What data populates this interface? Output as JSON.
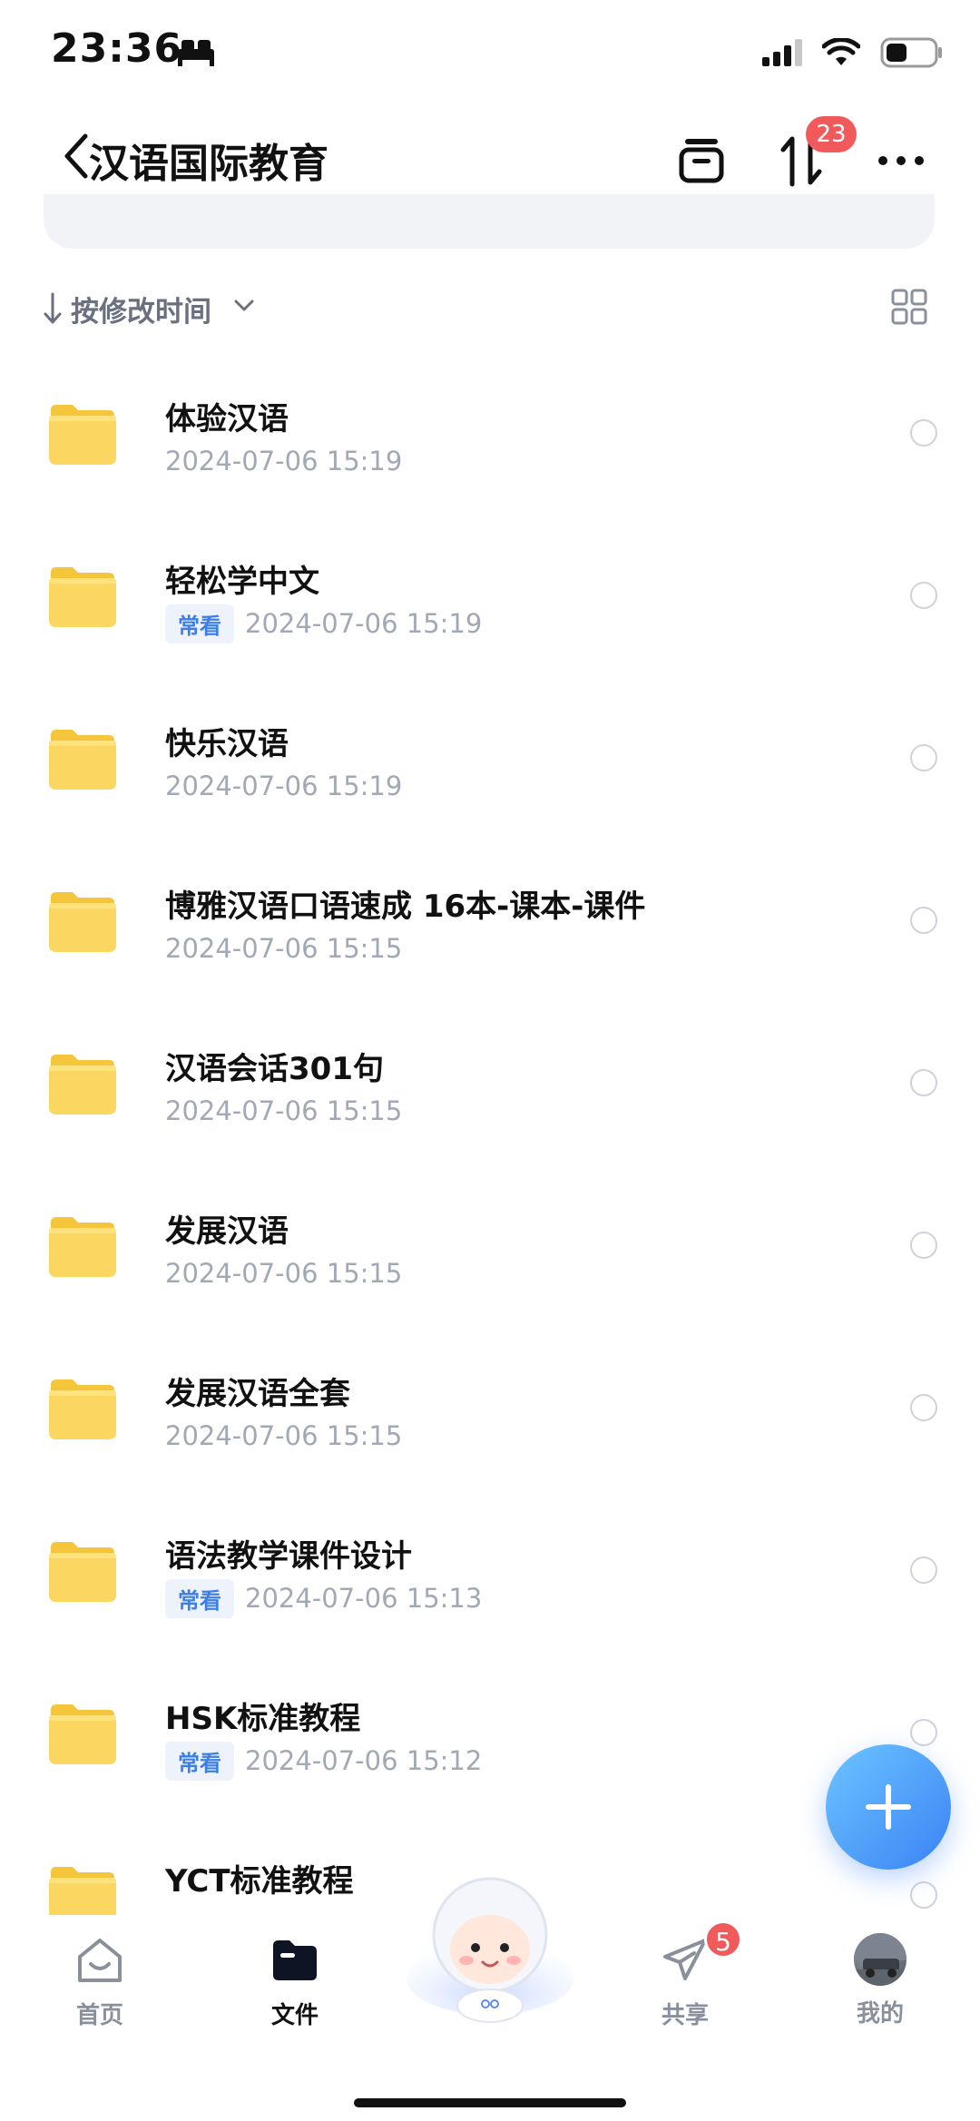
{
  "status_bar": {
    "time": "23:36"
  },
  "nav": {
    "title": "汉语国际教育",
    "badge_count": "23"
  },
  "sort": {
    "label": "按修改时间"
  },
  "files": [
    {
      "name": "体验汉语",
      "tag": "",
      "date": "2024-07-06 15:19"
    },
    {
      "name": "轻松学中文",
      "tag": "常看",
      "date": "2024-07-06 15:19"
    },
    {
      "name": "快乐汉语",
      "tag": "",
      "date": "2024-07-06 15:19"
    },
    {
      "name": "博雅汉语口语速成 16本-课本-课件",
      "tag": "",
      "date": "2024-07-06 15:15"
    },
    {
      "name": "汉语会话301句",
      "tag": "",
      "date": "2024-07-06 15:15"
    },
    {
      "name": "发展汉语",
      "tag": "",
      "date": "2024-07-06 15:15"
    },
    {
      "name": "发展汉语全套",
      "tag": "",
      "date": "2024-07-06 15:15"
    },
    {
      "name": "语法教学课件设计",
      "tag": "常看",
      "date": "2024-07-06 15:13"
    },
    {
      "name": "HSK标准教程",
      "tag": "常看",
      "date": "2024-07-06 15:12"
    },
    {
      "name": "YCT标准教程",
      "tag": "",
      "date": ""
    }
  ],
  "tabs": [
    {
      "label": "首页",
      "icon": "home-icon"
    },
    {
      "label": "文件",
      "icon": "folder-icon"
    },
    {
      "label": "共享",
      "icon": "share-icon"
    },
    {
      "label": "我的",
      "icon": "avatar"
    }
  ],
  "share_badge": "5",
  "colors": {
    "accent": "#3b82f6",
    "badge": "#f05a5a",
    "folder": "#fbd14f",
    "tag_bg": "#eef3fb",
    "tag_text": "#3d7fe6"
  }
}
